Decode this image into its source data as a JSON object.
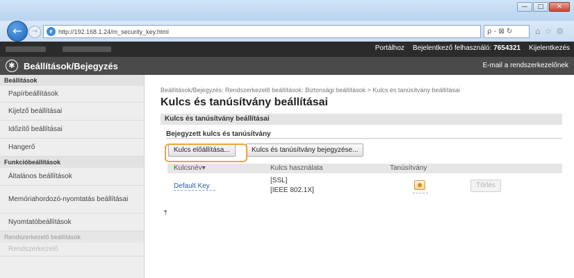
{
  "browser": {
    "url": "http://192.168.1.24/m_security_key.html",
    "search_placeholder": "ρ - ⊠ ↻",
    "window_controls": [
      "—",
      "□",
      "✕"
    ],
    "tool_icons": [
      "⌂",
      "☆",
      "⚙"
    ]
  },
  "topstrip": {
    "links": [
      "Portálhoz",
      "Bejelentkező felhasználó:",
      "7654321",
      "Kijelentkezés"
    ]
  },
  "header": {
    "title": "Beállítások/Bejegyzés",
    "admin_mail": "E-mail a rendszerkezelőnek"
  },
  "sidebar": {
    "section1": "Beállítások",
    "items1": [
      "Papírbeállítások",
      "Kijelző beállításai",
      "Időzítő beállításai",
      "Hangerő"
    ],
    "section2": "Funkcióbeállítások",
    "items2": [
      "Általános beállítások",
      "Memóriahordozó-nyomtatás beállításai",
      "Nyomtatóbeállítások"
    ],
    "section3": "Rendszerkezelő beállítások",
    "items3": [
      "Rendszerkezelő"
    ]
  },
  "main": {
    "breadcrumb": "Beállítások/Bejegyzés: Rendszerkezelő beállítások: Biztonsági beállítások > Kulcs és tanúsítvány beállításai",
    "title": "Kulcs és tanúsítvány beállításai",
    "section": "Kulcs és tanúsítvány beállításai",
    "subsection": "Bejegyzett kulcs és tanúsítvány",
    "buttons": {
      "generate": "Kulcs előállítása...",
      "register": "Kulcs és tanúsítvány bejegyzése..."
    },
    "table": {
      "headers": [
        "Kulcsnév▾",
        "Kulcs használata",
        "Tanúsítvány",
        ""
      ],
      "rows": [
        {
          "name": "Default Key",
          "usage_1": "[SSL]",
          "usage_2": "[IEEE 802.1X]",
          "delete": "Törlés"
        }
      ]
    },
    "top_icon": "⤒"
  }
}
